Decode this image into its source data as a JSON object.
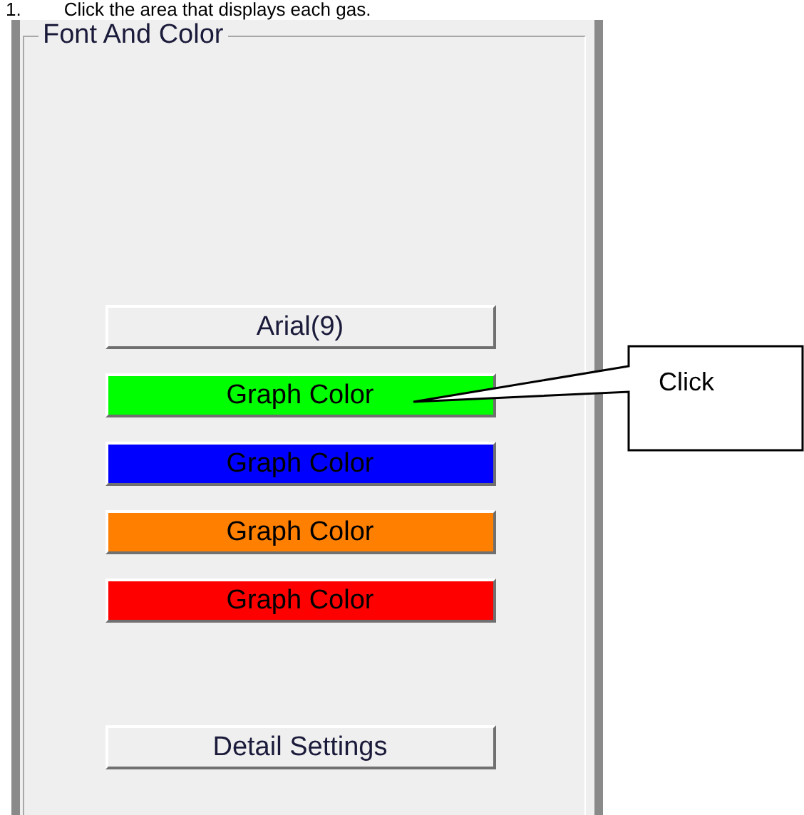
{
  "instruction": {
    "number": "1.",
    "text": "Click the area that displays each gas."
  },
  "font_and_color": {
    "group_title": "Font And Color",
    "font_button": {
      "label": "Arial(9)"
    },
    "graph_color_buttons": [
      {
        "label": "Graph Color",
        "color": "#00ff00"
      },
      {
        "label": "Graph Color",
        "color": "#0000ff"
      },
      {
        "label": "Graph Color",
        "color": "#ff8000"
      },
      {
        "label": "Graph Color",
        "color": "#ff0000"
      }
    ],
    "detail_button": {
      "label": "Detail Settings"
    }
  },
  "callout": {
    "text": "Click"
  }
}
